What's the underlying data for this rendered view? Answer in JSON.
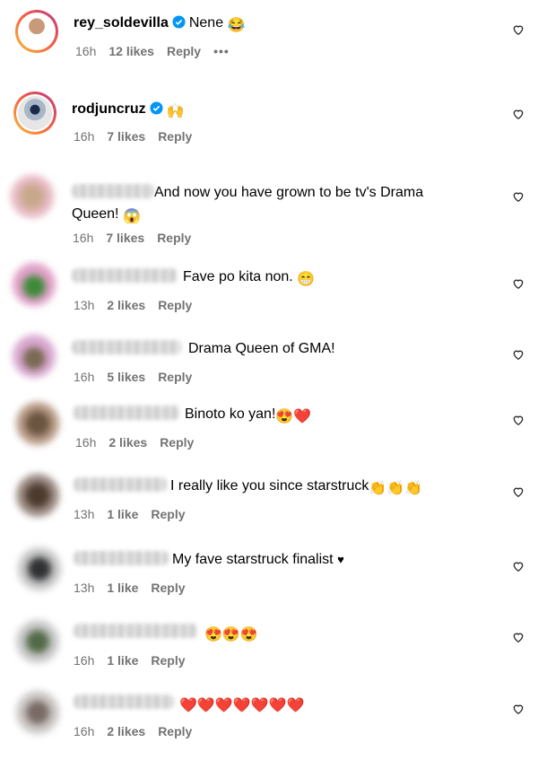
{
  "comments": [
    {
      "user": "rey_soldevilla",
      "verified": true,
      "text": "Nene",
      "emoji": "😂",
      "time": "16h",
      "likes": "12 likes",
      "reply": "Reply",
      "more": "•••"
    },
    {
      "user": "rodjuncruz",
      "verified": true,
      "text": "",
      "emoji": "🙌",
      "time": "16h",
      "likes": "7 likes",
      "reply": "Reply"
    },
    {
      "user": "",
      "text": "And now you have grown to be tv's Drama",
      "text2": "Queen!",
      "emoji": "😱",
      "time": "16h",
      "likes": "7 likes",
      "reply": "Reply"
    },
    {
      "user": "",
      "text": "Fave po kita non.",
      "emoji": "😁",
      "time": "13h",
      "likes": "2 likes",
      "reply": "Reply"
    },
    {
      "user": "",
      "text": "Drama Queen of GMA!",
      "time": "16h",
      "likes": "5 likes",
      "reply": "Reply"
    },
    {
      "user": "",
      "text": "Binoto ko yan!",
      "emoji": "😍❤️",
      "time": "16h",
      "likes": "2 likes",
      "reply": "Reply"
    },
    {
      "user": "",
      "text": "I really like you since starstruck",
      "emoji": "👏👏👏",
      "time": "13h",
      "likes": "1 like",
      "reply": "Reply"
    },
    {
      "user": "",
      "text": "My fave starstruck finalist",
      "emoji": "♥",
      "time": "13h",
      "likes": "1 like",
      "reply": "Reply"
    },
    {
      "user": "",
      "text": "",
      "emoji": "😍😍😍",
      "time": "16h",
      "likes": "1 like",
      "reply": "Reply"
    },
    {
      "user": "",
      "text": "",
      "emoji": "❤️❤️❤️❤️❤️❤️❤️",
      "time": "16h",
      "likes": "2 likes",
      "reply": "Reply"
    }
  ],
  "icons": {
    "like": "heart-outline-icon",
    "verified": "verified-badge-icon",
    "more": "more-options-icon"
  },
  "colors": {
    "meta": "#737373",
    "verified": "#0095f6",
    "heart": "#e0245e"
  }
}
